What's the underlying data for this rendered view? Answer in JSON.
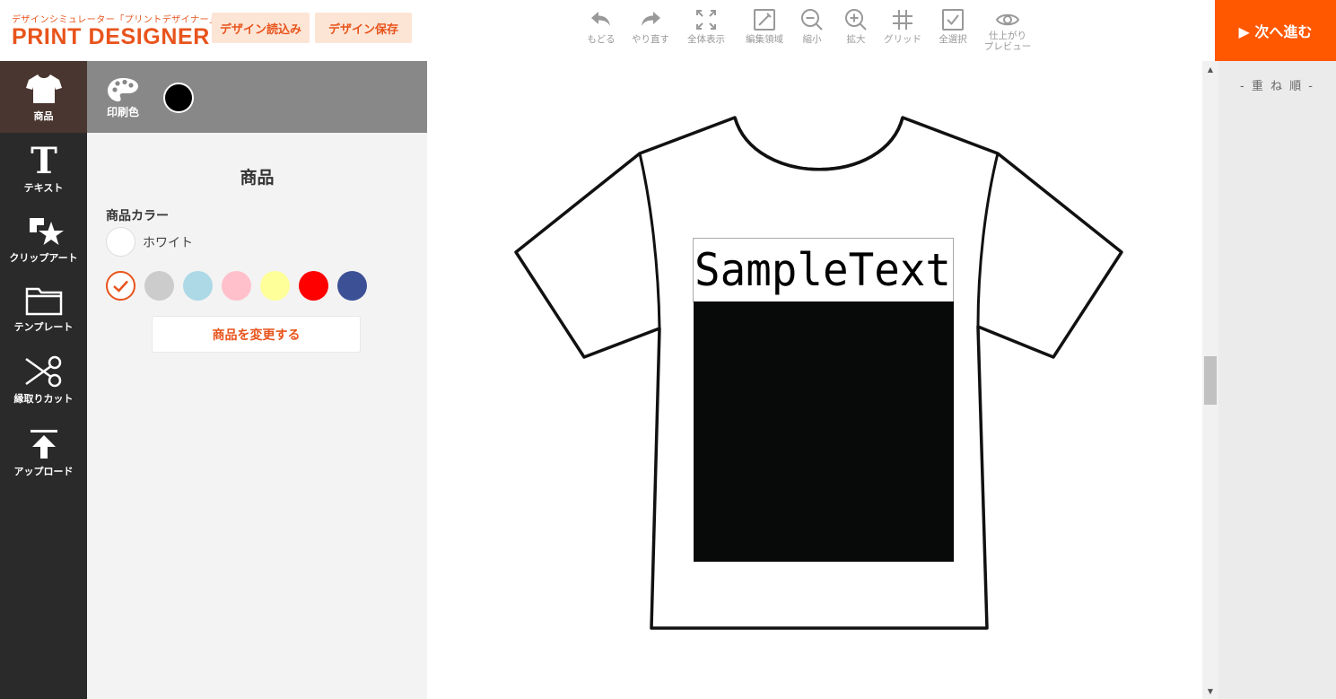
{
  "header": {
    "logo_sub": "デザインシミュレーター「プリントデザイナー」",
    "logo_main": "PRINT DESIGNER",
    "load_button": "デザイン読込み",
    "save_button": "デザイン保存",
    "next_button": "▶ 次へ進む"
  },
  "toolbar": {
    "undo": "もどる",
    "redo": "やり直す",
    "fit": "全体表示",
    "edit_area": "編集領域",
    "zoom_out": "縮小",
    "zoom_in": "拡大",
    "grid": "グリッド",
    "select_all": "全選択",
    "preview": "仕上がり\nプレビュー"
  },
  "leftnav": {
    "product": "商品",
    "text": "テキスト",
    "clipart": "クリップアート",
    "template": "テンプレート",
    "cutout": "縁取りカット",
    "upload": "アップロード"
  },
  "panel": {
    "print_color_label": "印刷色",
    "print_color_value": "#000000",
    "title": "商品",
    "color_heading": "商品カラー",
    "current_color_name": "ホワイト",
    "swatches": [
      "#ffffff",
      "#cccccc",
      "#add8e6",
      "#ffc0cb",
      "#ffff99",
      "#ff0000",
      "#3c5096"
    ],
    "change_button": "商品を変更する"
  },
  "canvas": {
    "design_text": "SampleText",
    "design_block_color": "#080a09"
  },
  "rightpanel": {
    "layer_title": "- 重 ね 順 -"
  },
  "colors": {
    "accent": "#e8541c",
    "next_button_bg": "#ff5800"
  }
}
